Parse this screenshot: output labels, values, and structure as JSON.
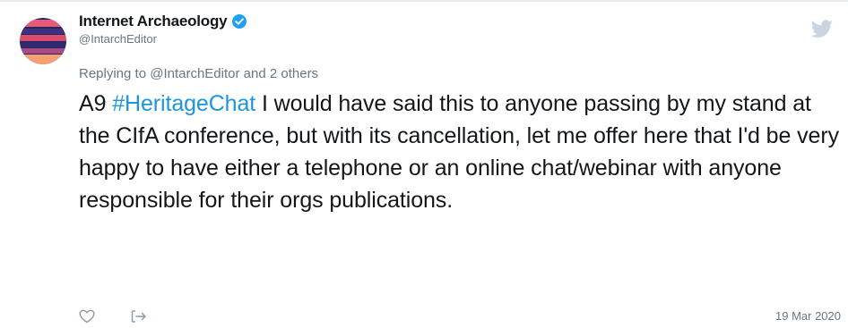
{
  "tweet": {
    "display_name": "Internet Archaeology",
    "handle": "@IntarchEditor",
    "reply_context": {
      "prefix": "Replying to ",
      "mention": "@IntarchEditor",
      "suffix": " and 2 others"
    },
    "text_parts": {
      "lead": "A9 ",
      "hashtag": "#HeritageChat",
      "body": " I would have said this to anyone passing by my stand at the CIfA conference, but with its cancellation, let me offer here that I'd be very happy to have either a telephone or an online chat/webinar with anyone responsible for their orgs publications."
    },
    "timestamp": "19 Mar 2020"
  },
  "icons": {
    "verified": "verified-badge-icon",
    "twitter": "twitter-bird-icon",
    "like": "heart-icon",
    "share": "share-icon"
  },
  "colors": {
    "hashtag": "#1b95e0",
    "verified": "#1da1f2",
    "muted": "#657786",
    "text": "#14171a"
  }
}
